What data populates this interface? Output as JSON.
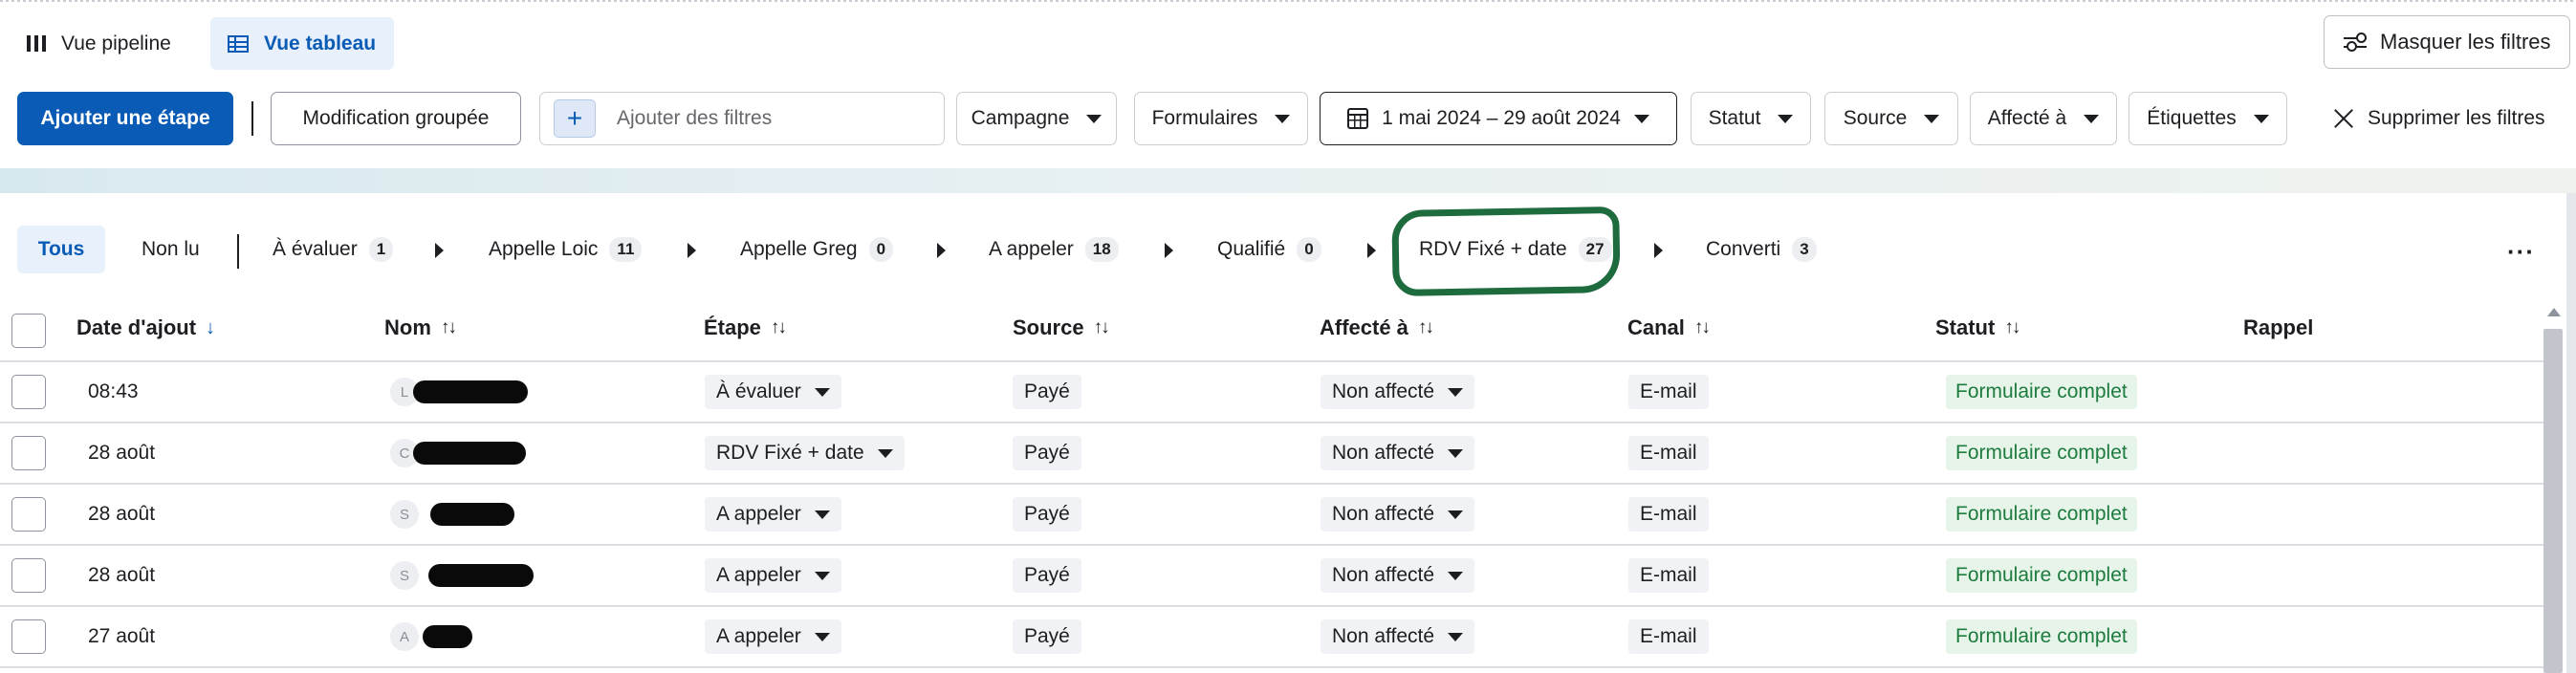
{
  "views": {
    "pipeline_label": "Vue pipeline",
    "table_label": "Vue tableau"
  },
  "toolbar": {
    "hide_filters_label": "Masquer les filtres",
    "add_step_label": "Ajouter une étape",
    "bulk_edit_label": "Modification groupée",
    "add_filters_placeholder": "Ajouter des filtres",
    "filters": {
      "campaign": "Campagne",
      "forms": "Formulaires",
      "date_range": "1 mai 2024 – 29 août 2024",
      "status": "Statut",
      "source": "Source",
      "assigned": "Affecté à",
      "labels": "Étiquettes"
    },
    "clear_filters_label": "Supprimer les filtres"
  },
  "stage_tabs": {
    "all": "Tous",
    "unread": "Non lu",
    "stages": [
      {
        "label": "À évaluer",
        "count": "1"
      },
      {
        "label": "Appelle Loic",
        "count": "11"
      },
      {
        "label": "Appelle Greg",
        "count": "0"
      },
      {
        "label": "A appeler",
        "count": "18"
      },
      {
        "label": "Qualifié",
        "count": "0"
      },
      {
        "label": "RDV Fixé + date",
        "count": "27"
      },
      {
        "label": "Converti",
        "count": "3"
      }
    ],
    "more": "···"
  },
  "table": {
    "columns": {
      "date": "Date d'ajout",
      "name": "Nom",
      "stage": "Étape",
      "source": "Source",
      "assigned": "Affecté à",
      "channel": "Canal",
      "status": "Statut",
      "reminder": "Rappel"
    },
    "rows": [
      {
        "date": "08:43",
        "initial": "L",
        "stage": "À évaluer",
        "source": "Payé",
        "assigned": "Non affecté",
        "channel": "E-mail",
        "status": "Formulaire complet"
      },
      {
        "date": "28 août",
        "initial": "C",
        "stage": "RDV Fixé + date",
        "source": "Payé",
        "assigned": "Non affecté",
        "channel": "E-mail",
        "status": "Formulaire complet"
      },
      {
        "date": "28 août",
        "initial": "S",
        "stage": "A appeler",
        "source": "Payé",
        "assigned": "Non affecté",
        "channel": "E-mail",
        "status": "Formulaire complet"
      },
      {
        "date": "28 août",
        "initial": "S",
        "stage": "A appeler",
        "source": "Payé",
        "assigned": "Non affecté",
        "channel": "E-mail",
        "status": "Formulaire complet"
      },
      {
        "date": "27 août",
        "initial": "A",
        "stage": "A appeler",
        "source": "Payé",
        "assigned": "Non affecté",
        "channel": "E-mail",
        "status": "Formulaire complet"
      }
    ]
  },
  "colors": {
    "primary": "#0a5bb5",
    "status_bg": "#e6f4ea",
    "status_text": "#1e7b3e",
    "highlight_ring": "#1e6b3e"
  }
}
